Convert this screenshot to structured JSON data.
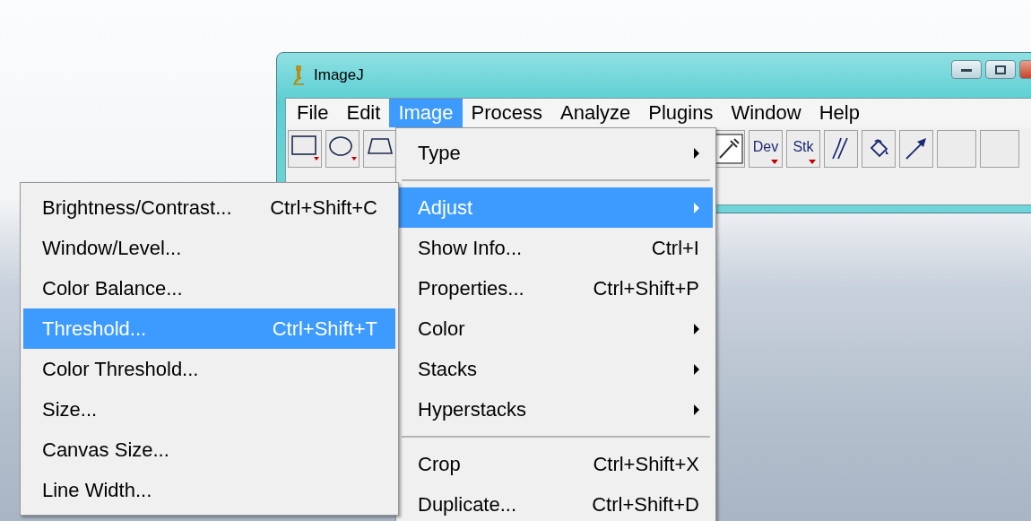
{
  "window": {
    "title": "ImageJ"
  },
  "menubar": [
    {
      "label": "File",
      "selected": false
    },
    {
      "label": "Edit",
      "selected": false
    },
    {
      "label": "Image",
      "selected": true
    },
    {
      "label": "Process",
      "selected": false
    },
    {
      "label": "Analyze",
      "selected": false
    },
    {
      "label": "Plugins",
      "selected": false
    },
    {
      "label": "Window",
      "selected": false
    },
    {
      "label": "Help",
      "selected": false
    }
  ],
  "toolbar": {
    "left": [
      {
        "kind": "rectangle"
      },
      {
        "kind": "oval"
      },
      {
        "kind": "polygon"
      }
    ],
    "right": [
      {
        "kind": "dropper"
      },
      {
        "kind": "text",
        "label": "Dev"
      },
      {
        "kind": "text",
        "label": "Stk"
      },
      {
        "kind": "brush"
      },
      {
        "kind": "fill"
      },
      {
        "kind": "arrow"
      },
      {
        "kind": "blank"
      },
      {
        "kind": "blank"
      }
    ]
  },
  "image_menu": {
    "items": [
      {
        "kind": "submenu",
        "label": "Type",
        "selected": false
      },
      {
        "kind": "separator"
      },
      {
        "kind": "submenu",
        "label": "Adjust",
        "selected": true
      },
      {
        "kind": "command",
        "label": "Show Info...",
        "shortcut": "Ctrl+I",
        "selected": false
      },
      {
        "kind": "command",
        "label": "Properties...",
        "shortcut": "Ctrl+Shift+P",
        "selected": false
      },
      {
        "kind": "submenu",
        "label": "Color",
        "selected": false
      },
      {
        "kind": "submenu",
        "label": "Stacks",
        "selected": false
      },
      {
        "kind": "submenu",
        "label": "Hyperstacks",
        "selected": false
      },
      {
        "kind": "separator"
      },
      {
        "kind": "command",
        "label": "Crop",
        "shortcut": "Ctrl+Shift+X",
        "selected": false
      },
      {
        "kind": "command",
        "label": "Duplicate...",
        "shortcut": "Ctrl+Shift+D",
        "selected": false
      }
    ]
  },
  "adjust_menu": {
    "items": [
      {
        "kind": "command",
        "label": "Brightness/Contrast...",
        "shortcut": "Ctrl+Shift+C",
        "selected": false
      },
      {
        "kind": "command",
        "label": "Window/Level...",
        "selected": false
      },
      {
        "kind": "command",
        "label": "Color Balance...",
        "selected": false
      },
      {
        "kind": "command",
        "label": "Threshold...",
        "shortcut": "Ctrl+Shift+T",
        "selected": true
      },
      {
        "kind": "command",
        "label": "Color Threshold...",
        "selected": false
      },
      {
        "kind": "command",
        "label": "Size...",
        "selected": false
      },
      {
        "kind": "command",
        "label": "Canvas Size...",
        "selected": false
      },
      {
        "kind": "command",
        "label": "Line Width...",
        "selected": false
      }
    ]
  }
}
